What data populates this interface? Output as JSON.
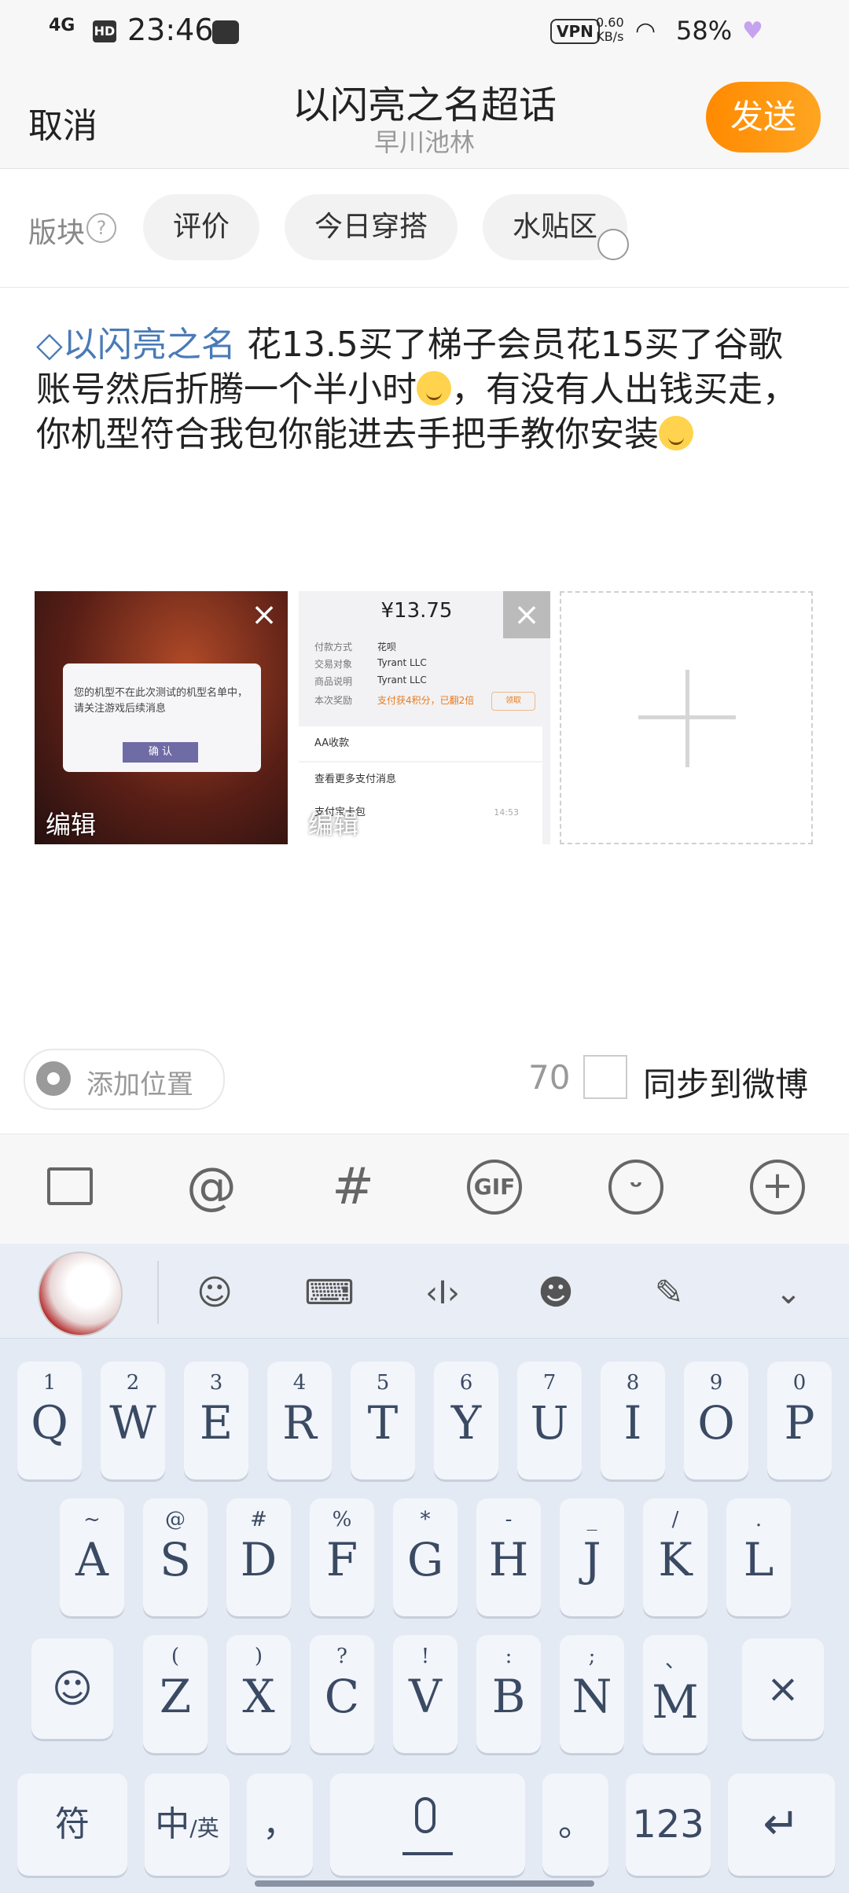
{
  "status": {
    "network": "4G",
    "hd": "HD",
    "time": "23:46",
    "vpn": "VPN",
    "speed_value": "0.60",
    "speed_unit": "KB/s",
    "battery": "58%"
  },
  "header": {
    "cancel": "取消",
    "title": "以闪亮之名超话",
    "subtitle": "早川池林",
    "send": "发送"
  },
  "section": {
    "label": "版块",
    "help": "?",
    "tags": [
      "评价",
      "今日穿搭",
      "水贴区"
    ]
  },
  "post": {
    "topic": "以闪亮之名",
    "text_1": " 花13.5买了梯子会员花15买了谷歌账号然后折腾一个半小时",
    "text_2": "，有没有人出钱买走，你机型符合我包你能进去手把手教你安装"
  },
  "images": {
    "edit_label": "编辑",
    "close": "×",
    "img1_dialog_text": "您的机型不在此次测试的机型名单中，请关注游戏后续消息",
    "img1_dialog_button": "确 认",
    "img2_amount": "¥13.75",
    "img2_rows": [
      {
        "k": "付款方式",
        "v": "花呗"
      },
      {
        "k": "交易对象",
        "v": "Tyrant LLC"
      },
      {
        "k": "商品说明",
        "v": "Tyrant LLC"
      },
      {
        "k": "本次奖励",
        "v": "支付获4积分，已翻2倍"
      }
    ],
    "img2_reward_btn": "领取",
    "img2_aa": "AA收款",
    "img2_more": "查看更多支付消息",
    "img2_wallet": "支付宝卡包",
    "img2_wallet_time": "14:53"
  },
  "footer": {
    "location": "添加位置",
    "count": "70",
    "sync": "同步到微博"
  },
  "toolbar": {
    "icons": [
      "image-icon",
      "at-icon",
      "hashtag-icon",
      "gif-icon",
      "emoji-icon",
      "add-icon"
    ],
    "gif": "GIF"
  },
  "keyboard": {
    "row1": [
      {
        "n": "1",
        "l": "Q"
      },
      {
        "n": "2",
        "l": "W"
      },
      {
        "n": "3",
        "l": "E"
      },
      {
        "n": "4",
        "l": "R"
      },
      {
        "n": "5",
        "l": "T"
      },
      {
        "n": "6",
        "l": "Y"
      },
      {
        "n": "7",
        "l": "U"
      },
      {
        "n": "8",
        "l": "I"
      },
      {
        "n": "9",
        "l": "O"
      },
      {
        "n": "0",
        "l": "P"
      }
    ],
    "row2": [
      {
        "n": "~",
        "l": "A"
      },
      {
        "n": "@",
        "l": "S"
      },
      {
        "n": "#",
        "l": "D"
      },
      {
        "n": "%",
        "l": "F"
      },
      {
        "n": "*",
        "l": "G"
      },
      {
        "n": "-",
        "l": "H"
      },
      {
        "n": "_",
        "l": "J"
      },
      {
        "n": "/",
        "l": "K"
      },
      {
        "n": ".",
        "l": "L"
      }
    ],
    "row3": [
      {
        "n": "(",
        "l": "Z"
      },
      {
        "n": ")",
        "l": "X"
      },
      {
        "n": "?",
        "l": "C"
      },
      {
        "n": "!",
        "l": "V"
      },
      {
        "n": ":",
        "l": "B"
      },
      {
        "n": ";",
        "l": "N"
      },
      {
        "n": "、",
        "l": "M"
      }
    ],
    "symbols": "符",
    "lang_main": "中",
    "lang_sub": "/英",
    "comma": "，",
    "period": "。",
    "numbers": "123",
    "enter": "↵",
    "backspace": "×"
  }
}
